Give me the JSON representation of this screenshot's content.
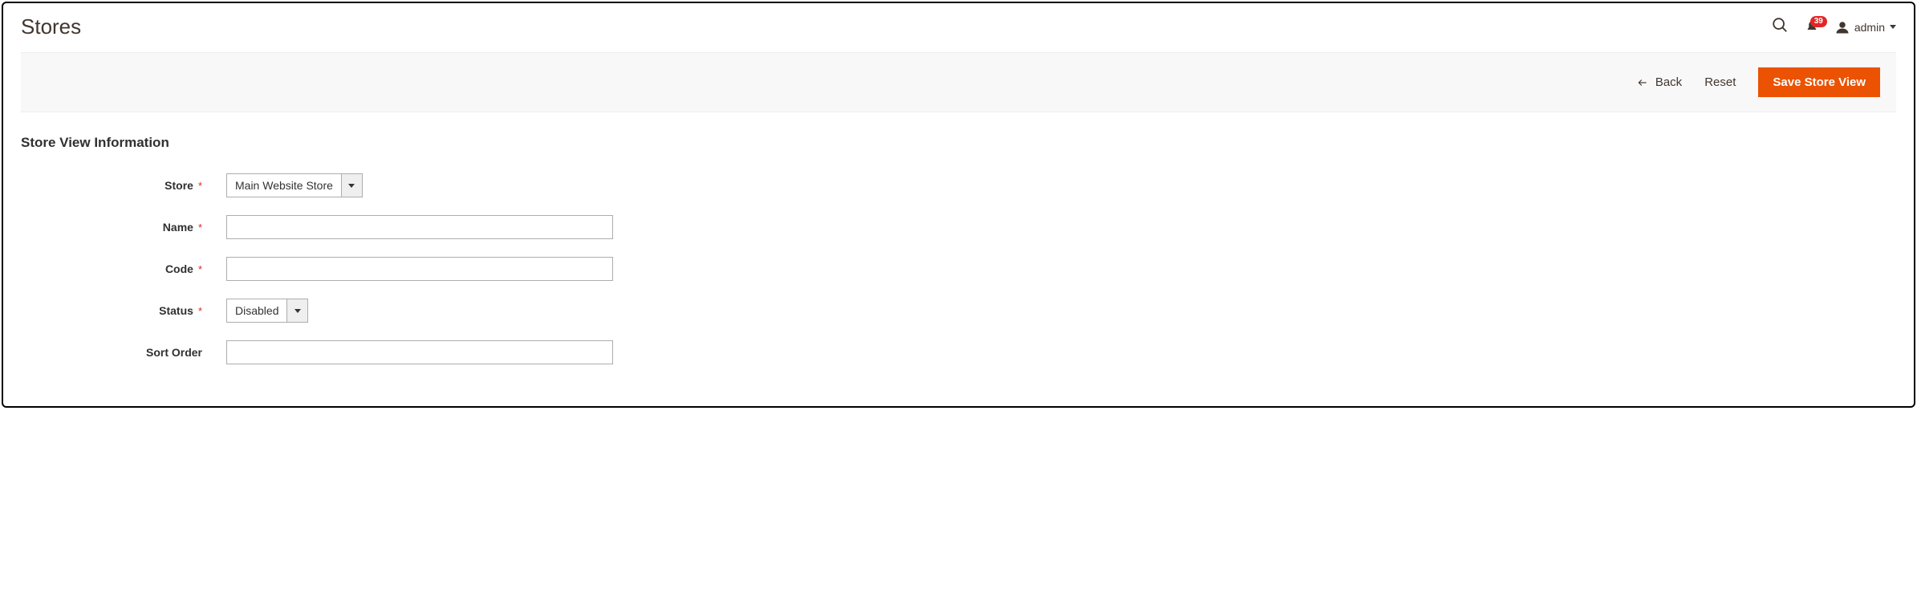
{
  "header": {
    "title": "Stores",
    "notification_count": "39",
    "account_name": "admin"
  },
  "action_bar": {
    "back_label": "Back",
    "reset_label": "Reset",
    "save_label": "Save Store View"
  },
  "section": {
    "title": "Store View Information"
  },
  "form": {
    "store": {
      "label": "Store",
      "selected": "Main Website Store"
    },
    "name": {
      "label": "Name",
      "value": ""
    },
    "code": {
      "label": "Code",
      "value": ""
    },
    "status": {
      "label": "Status",
      "selected": "Disabled"
    },
    "sort_order": {
      "label": "Sort Order",
      "value": ""
    }
  }
}
